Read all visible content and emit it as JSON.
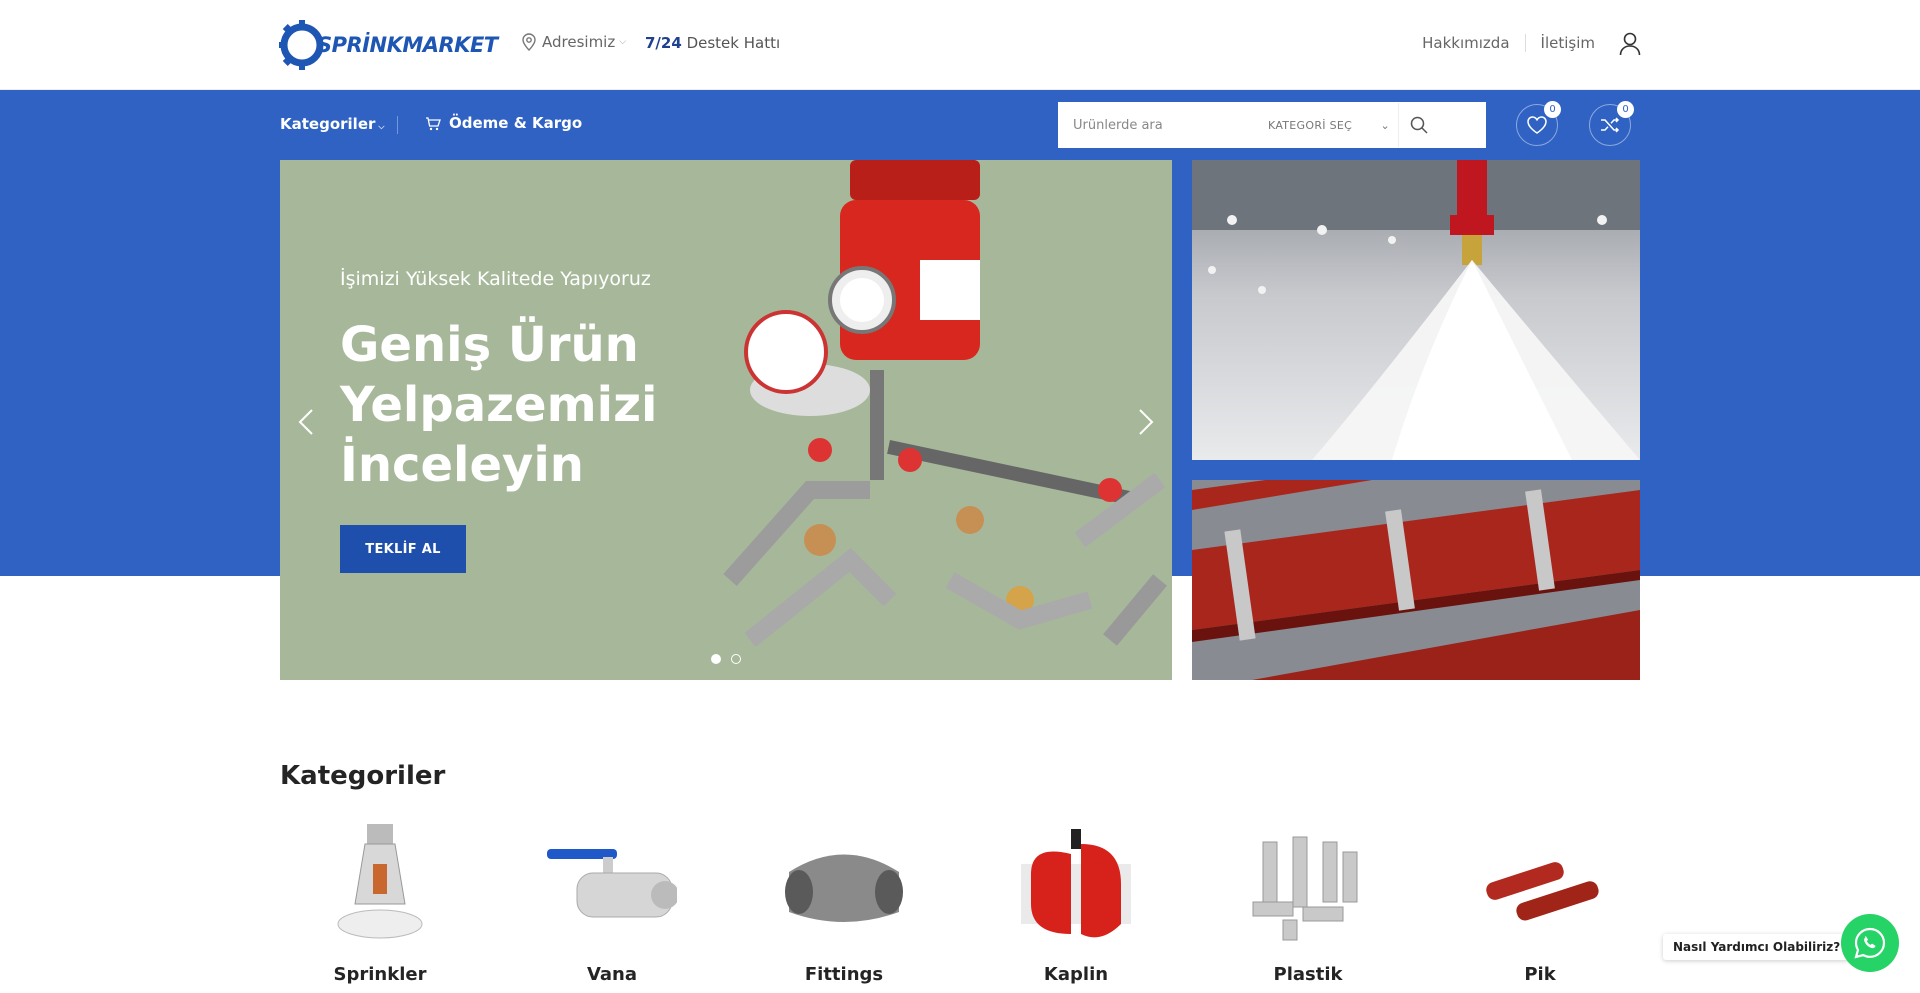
{
  "brand": {
    "name": "SPRİNKMARKET",
    "color": "#1e56b3"
  },
  "header": {
    "location": "Adresimiz",
    "support_bold": "7/24",
    "support_text": "Destek Hattı",
    "links": [
      "Hakkımızda",
      "İletişim"
    ]
  },
  "nav": {
    "categories": "Kategoriler",
    "payment": "Ödeme & Kargo",
    "search_placeholder": "Ürünlerde ara",
    "category_select": "KATEGORİ SEÇ",
    "wishlist_count": "0",
    "compare_count": "0",
    "bar_color": "#2f62c3"
  },
  "hero": {
    "subtitle": "İşimizi Yüksek Kalitede Yapıyoruz",
    "title": "Geniş Ürün Yelpazemizi İnceleyin",
    "button": "TEKLİF AL",
    "slides": 2,
    "active_slide": 1
  },
  "categories": {
    "heading": "Kategoriler",
    "items": [
      "Sprinkler",
      "Vana",
      "Fittings",
      "Kaplin",
      "Plastik",
      "Pik"
    ]
  },
  "whatsapp": {
    "prompt": "Nasıl Yardımcı Olabiliriz?",
    "color": "#25d366"
  }
}
